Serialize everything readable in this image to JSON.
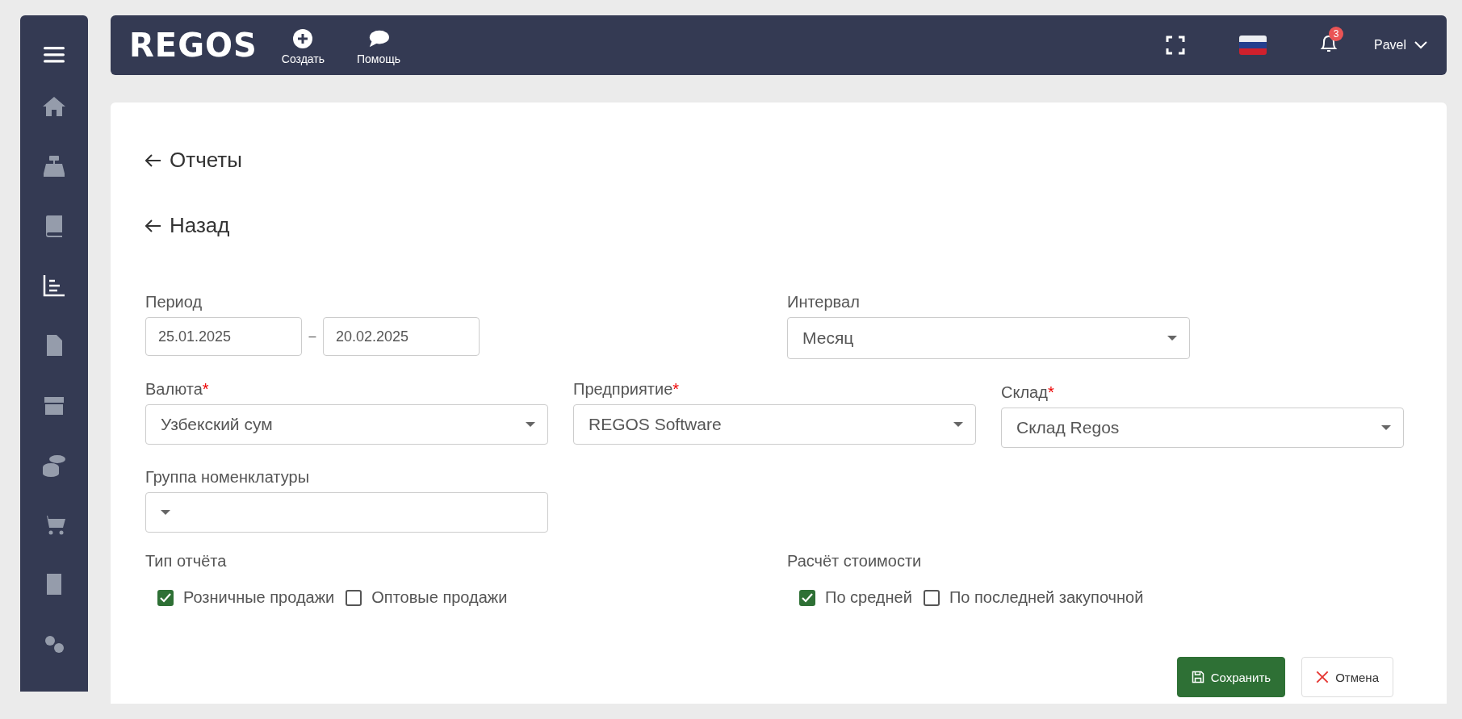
{
  "sidebar": {
    "items": [
      {
        "selected": false
      },
      {
        "selected": false
      },
      {
        "selected": false
      },
      {
        "selected": true
      },
      {
        "selected": false
      },
      {
        "selected": false
      },
      {
        "selected": false
      },
      {
        "selected": false
      },
      {
        "selected": false
      },
      {
        "selected": false
      }
    ]
  },
  "header": {
    "logo": "REGOS",
    "actions": [
      {
        "kind": "create",
        "label": "Создать"
      },
      {
        "kind": "help",
        "label": "Помощь"
      }
    ],
    "notifications": "3",
    "user": "Pavel"
  },
  "breadcrumb": "Отчеты",
  "back": "Назад",
  "period": {
    "label": "Период",
    "from": "25.01.2025",
    "separator": "–",
    "to": "20.02.2025"
  },
  "interval": {
    "label": "Интервал",
    "value": "Месяц"
  },
  "selects": [
    {
      "label": "Валюта",
      "required_mark": "*",
      "value": "Узбекский сум"
    },
    {
      "label": "Предприятие",
      "required_mark": "*",
      "value": "REGOS Software"
    },
    {
      "label": "Склад",
      "required_mark": "*",
      "value": "Склад Regos"
    }
  ],
  "group": {
    "label": "Группа номенклатуры"
  },
  "report_type": {
    "label": "Тип отчёта",
    "options": [
      {
        "label": "Розничные продажи",
        "checked": true
      },
      {
        "label": "Оптовые продажи",
        "checked": false
      }
    ]
  },
  "cost_calc": {
    "label": "Расчёт стоимости",
    "options": [
      {
        "label": "По средней",
        "checked": true
      },
      {
        "label": "По последней закупочной",
        "checked": false
      }
    ]
  },
  "buttons": {
    "save": "Сохранить",
    "cancel": "Отмена"
  }
}
